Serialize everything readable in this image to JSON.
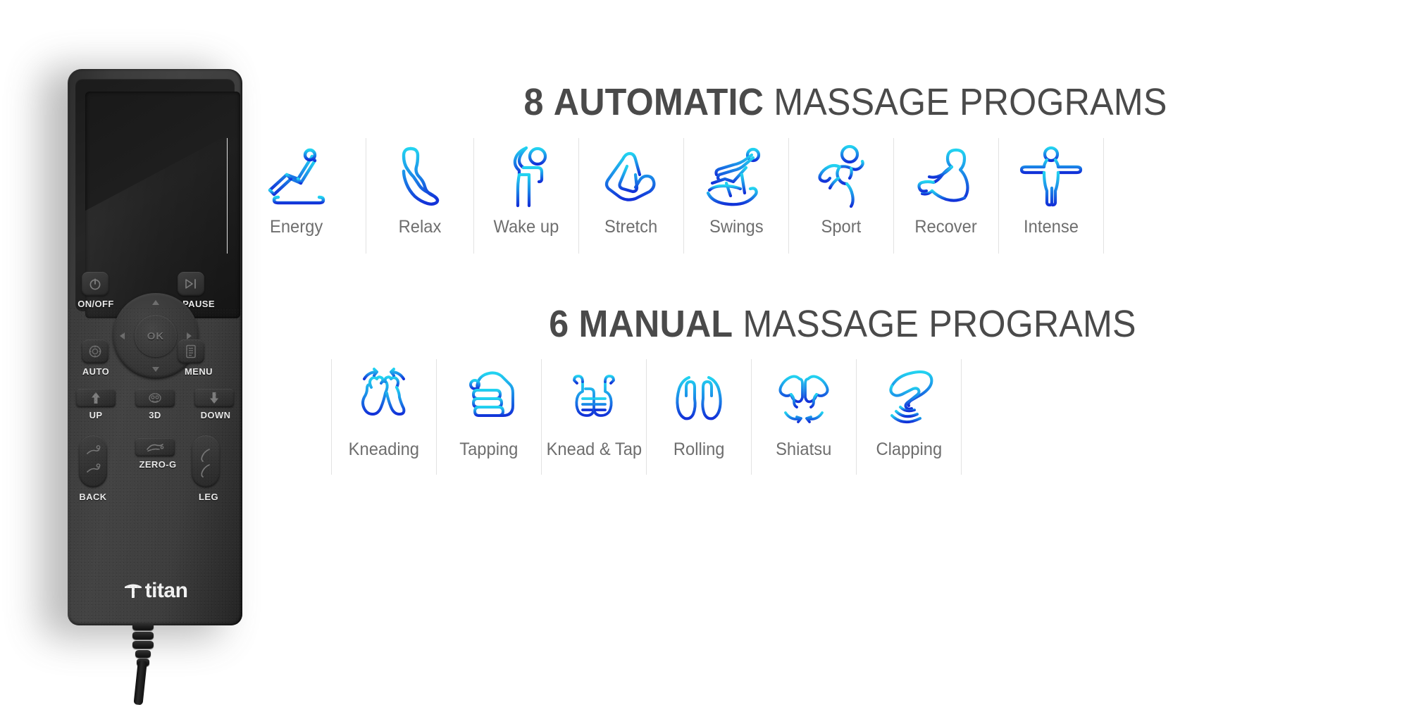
{
  "remote": {
    "brand": "titan",
    "buttons": [
      {
        "key": "on_off",
        "label": "ON/OFF",
        "icon": "power-icon"
      },
      {
        "key": "pause",
        "label": "PAUSE",
        "icon": "play-pause-icon"
      },
      {
        "key": "auto",
        "label": "AUTO",
        "icon": "auto-icon"
      },
      {
        "key": "menu",
        "label": "MENU",
        "icon": "menu-icon"
      },
      {
        "key": "up",
        "label": "UP",
        "icon": "arrow-up-icon"
      },
      {
        "key": "3d",
        "label": "3D",
        "icon": "three-d-icon"
      },
      {
        "key": "down",
        "label": "DOWN",
        "icon": "arrow-down-icon"
      },
      {
        "key": "back",
        "label": "BACK",
        "icon": "back-icon"
      },
      {
        "key": "zero_g",
        "label": "ZERO-G",
        "icon": "zero-g-icon"
      },
      {
        "key": "leg",
        "label": "LEG",
        "icon": "leg-icon"
      }
    ],
    "dpad": {
      "ok_label": "OK"
    }
  },
  "sections": [
    {
      "id": "automatic",
      "count": "8",
      "emphasis": "AUTOMATIC",
      "rest": "MASSAGE PROGRAMS",
      "programs": [
        {
          "label": "Energy",
          "icon": "chair-recline-icon"
        },
        {
          "label": "Relax",
          "icon": "body-relax-icon"
        },
        {
          "label": "Wake up",
          "icon": "person-stretch-arm-icon"
        },
        {
          "label": "Stretch",
          "icon": "stretch-fold-icon"
        },
        {
          "label": "Swings",
          "icon": "rocking-chair-icon"
        },
        {
          "label": "Sport",
          "icon": "runner-icon"
        },
        {
          "label": "Recover",
          "icon": "person-reclined-icon"
        },
        {
          "label": "Intense",
          "icon": "person-arms-out-icon"
        }
      ]
    },
    {
      "id": "manual",
      "count": "6",
      "emphasis": "MANUAL",
      "rest": "MASSAGE PROGRAMS",
      "programs": [
        {
          "label": "Kneading",
          "icon": "two-hands-rotate-icon"
        },
        {
          "label": "Tapping",
          "icon": "fist-icon"
        },
        {
          "label": "Knead & Tap",
          "icon": "two-thumbs-rotate-icon"
        },
        {
          "label": "Rolling",
          "icon": "two-hands-spine-icon"
        },
        {
          "label": "Shiatsu",
          "icon": "two-fingers-press-icon"
        },
        {
          "label": "Clapping",
          "icon": "hand-waves-icon"
        }
      ]
    }
  ],
  "colors": {
    "gradient_top": "#22d3f0",
    "gradient_bottom": "#1230d8",
    "title_text": "#4a4a4a",
    "label_text": "#6e6e6e",
    "divider": "#e2e2e2",
    "background": "#ffffff"
  }
}
